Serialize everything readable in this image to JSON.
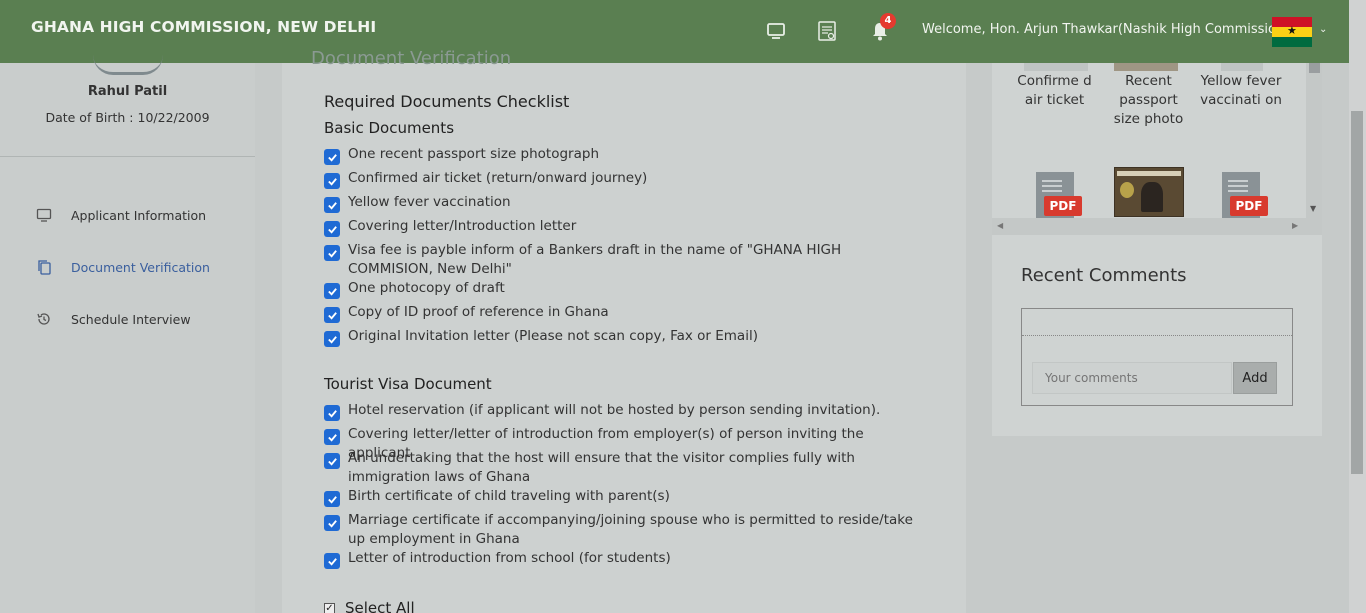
{
  "header": {
    "title": "GHANA HIGH COMMISSION, NEW DELHI",
    "notifications_count": "4",
    "welcome": "Welcome, Hon. Arjun Thawkar(Nashik High Commission)",
    "icons": [
      "monitor-icon",
      "document-list-icon",
      "bell-icon",
      "chevron-down-icon"
    ],
    "flag_colors": [
      "#ce1126",
      "#fcd116",
      "#006b3f"
    ]
  },
  "profile": {
    "name": "Rahul Patil",
    "dob": "Date of Birth : 10/22/2009"
  },
  "sidebar": {
    "items": [
      {
        "label": "Applicant Information",
        "icon": "monitor-icon",
        "active": false
      },
      {
        "label": "Document Verification",
        "icon": "copy-icon",
        "active": true
      },
      {
        "label": "Schedule Interview",
        "icon": "history-icon",
        "active": false
      }
    ]
  },
  "main": {
    "faded_title": "Document Verification",
    "checklist_title": "Required Documents Checklist",
    "basic_title": "Basic Documents",
    "basic_items": [
      "One recent passport size photograph",
      "Confirmed air ticket (return/onward journey)",
      "Yellow fever vaccination",
      "Covering letter/Introduction letter",
      "Visa fee is payble inform of a Bankers draft in the name of \"GHANA HIGH COMMISION, New Delhi\"",
      "One photocopy of draft",
      "Copy of ID proof of reference in Ghana",
      "Original Invitation letter (Please not scan copy, Fax or Email)"
    ],
    "tourist_title": "Tourist Visa Document",
    "tourist_items": [
      "Hotel reservation (if applicant will not be hosted by person sending invitation).",
      "Covering letter/letter of introduction from employer(s) of person inviting the applicant",
      "An undertaking that the host will ensure that the visitor complies fully with immigration laws of Ghana",
      "Birth certificate of child traveling with parent(s)",
      "Marriage certificate if accompanying/joining spouse who is permitted to reside/take up employment in Ghana",
      "Letter of introduction from school (for students)"
    ],
    "select_all": "Select All"
  },
  "documents": {
    "items": [
      {
        "label": "Confirme d air ticket"
      },
      {
        "label": "Recent passport size photo"
      },
      {
        "label": "Yellow fever vaccinati on"
      }
    ],
    "pdf_label": "PDF"
  },
  "comments": {
    "title": "Recent Comments",
    "placeholder": "Your comments",
    "add_label": "Add"
  },
  "colors": {
    "header_bg": "#5a7f51",
    "checkbox": "#1f6ad4",
    "active_nav": "#3a5f9e",
    "pdf_badge": "#d83a2e",
    "badge": "#e53a2f"
  }
}
